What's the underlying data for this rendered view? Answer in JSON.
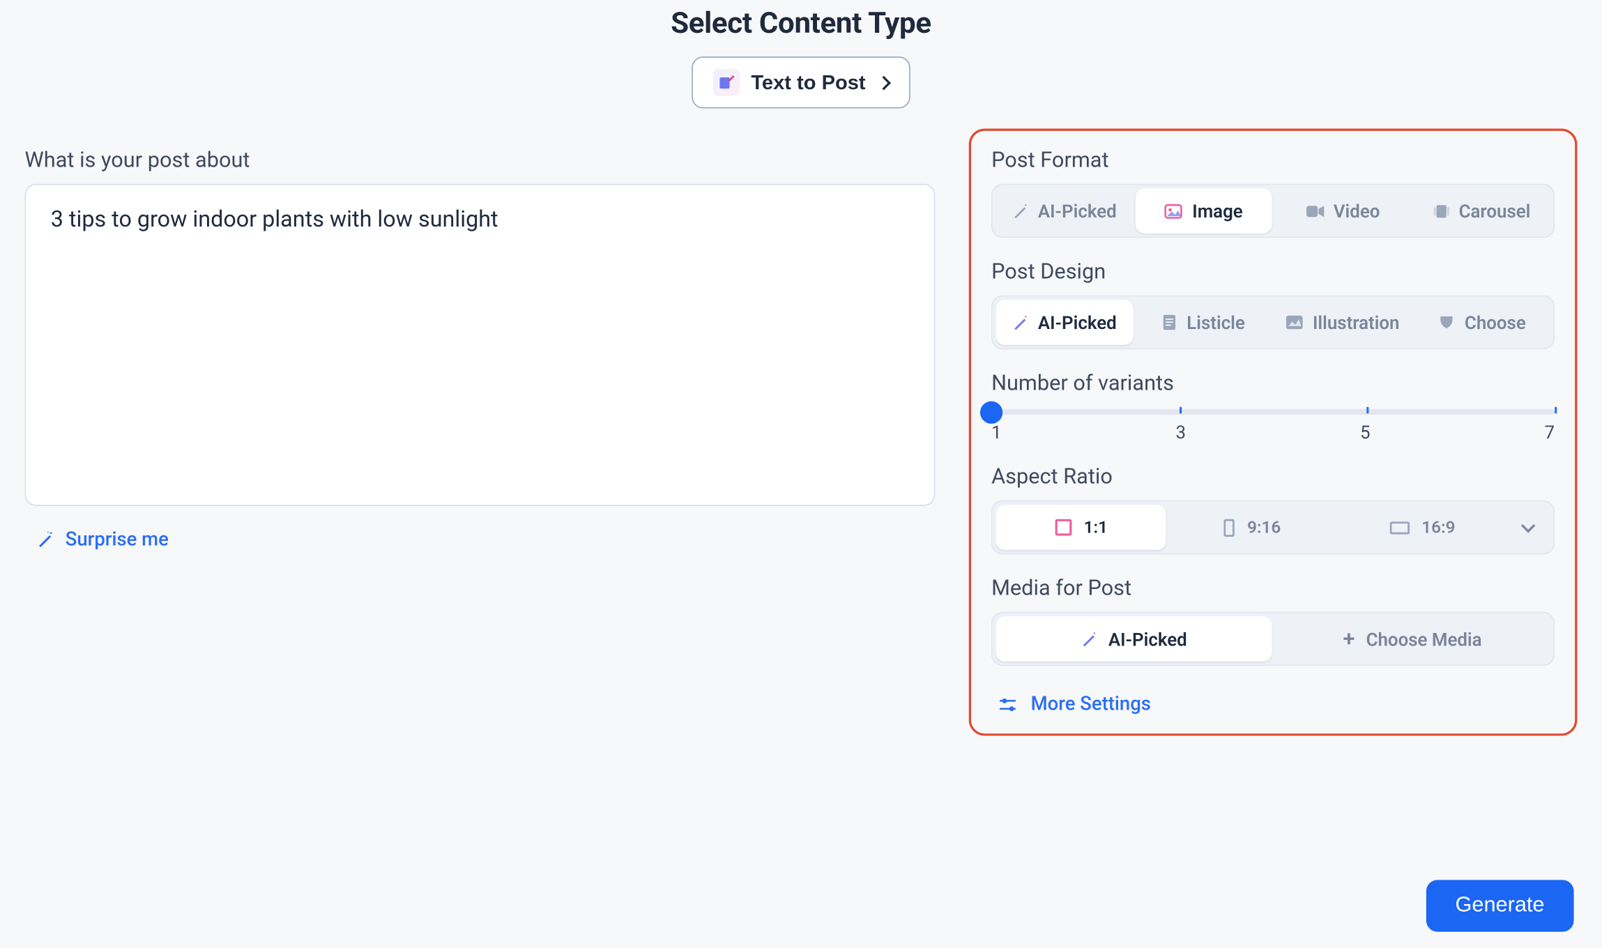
{
  "header": {
    "title": "Select Content Type",
    "content_type_label": "Text to Post"
  },
  "prompt": {
    "label": "What is your post about",
    "value": "3 tips to grow indoor plants with low sunlight",
    "surprise_label": "Surprise me"
  },
  "panel": {
    "post_format": {
      "label": "Post Format",
      "options": [
        "AI-Picked",
        "Image",
        "Video",
        "Carousel"
      ],
      "active_index": 1
    },
    "post_design": {
      "label": "Post Design",
      "options": [
        "AI-Picked",
        "Listicle",
        "Illustration",
        "Choose"
      ],
      "active_index": 0
    },
    "variants": {
      "label": "Number of variants",
      "ticks": [
        "1",
        "3",
        "5",
        "7"
      ],
      "value": 1
    },
    "aspect_ratio": {
      "label": "Aspect Ratio",
      "options": [
        "1:1",
        "9:16",
        "16:9"
      ],
      "active_index": 0
    },
    "media": {
      "label": "Media for Post",
      "options": [
        "AI-Picked",
        "Choose Media"
      ],
      "active_index": 0
    },
    "more_settings_label": "More Settings"
  },
  "generate_label": "Generate"
}
